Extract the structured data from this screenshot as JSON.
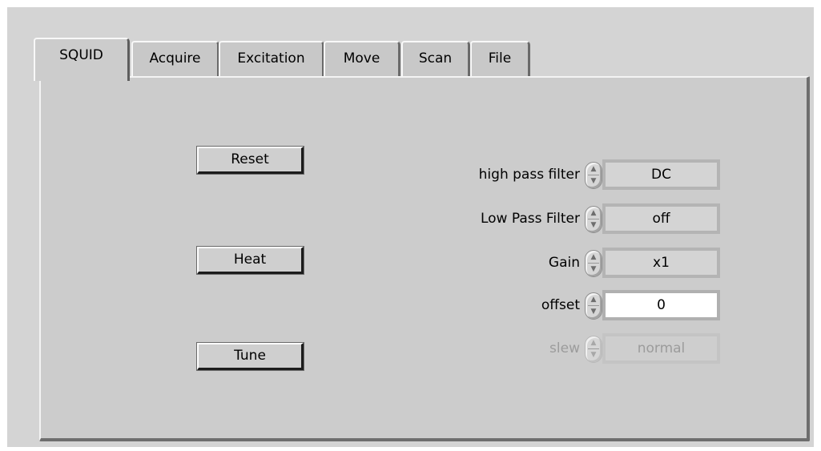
{
  "tabs": [
    {
      "label": "SQUID",
      "selected": true
    },
    {
      "label": "Acquire",
      "selected": false
    },
    {
      "label": "Excitation",
      "selected": false
    },
    {
      "label": "Move",
      "selected": false
    },
    {
      "label": "Scan",
      "selected": false
    },
    {
      "label": "File",
      "selected": false
    }
  ],
  "buttons": {
    "reset": "Reset",
    "heat": "Heat",
    "tune": "Tune"
  },
  "controls": [
    {
      "label": "high pass filter",
      "value": "DC",
      "editable": false,
      "enabled": true
    },
    {
      "label": "Low Pass Filter",
      "value": "off",
      "editable": false,
      "enabled": true
    },
    {
      "label": "Gain",
      "value": "x1",
      "editable": false,
      "enabled": true
    },
    {
      "label": "offset",
      "value": "0",
      "editable": true,
      "enabled": true
    },
    {
      "label": "slew",
      "value": "normal",
      "editable": false,
      "enabled": false
    }
  ],
  "icons": {
    "spinner": "up-down-spinner-icon"
  },
  "colors": {
    "panel": "#cccccc",
    "window": "#d4d4d4",
    "disabled_text": "#9c9c9c"
  }
}
